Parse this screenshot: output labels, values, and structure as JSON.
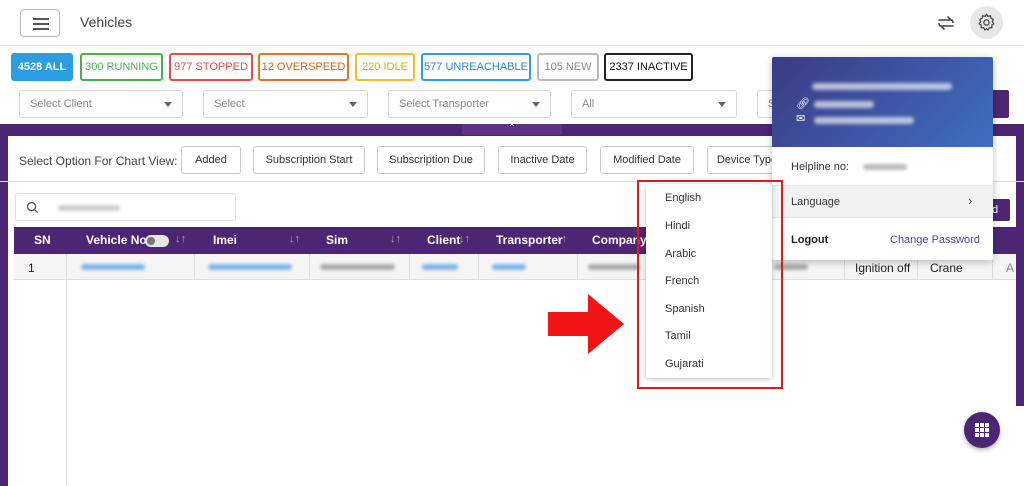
{
  "header": {
    "title": "Vehicles"
  },
  "status_chips": [
    {
      "label": "4528 ALL"
    },
    {
      "label": "300 RUNNING"
    },
    {
      "label": "977 STOPPED"
    },
    {
      "label": "12 OVERSPEED"
    },
    {
      "label": "220 IDLE"
    },
    {
      "label": "577 UNREACHABLE"
    },
    {
      "label": "105 NEW"
    },
    {
      "label": "2337 INACTIVE"
    }
  ],
  "filters": {
    "client_placeholder": "Select Client",
    "select_placeholder": "Select",
    "transporter_placeholder": "Select Transporter",
    "all_value": "All",
    "partial_label": "S"
  },
  "chart_view": {
    "label": "Select Option For Chart View:",
    "options": [
      "Added",
      "Subscription Start",
      "Subscription Due",
      "Inactive Date",
      "Modified Date",
      "Device Type"
    ]
  },
  "table": {
    "columns": [
      "SN",
      "Vehicle No.",
      "Imei",
      "Sim",
      "Client",
      "Transporter",
      "Company"
    ],
    "row": {
      "sn": "1",
      "ignition": "Ignition off",
      "type": "Crane",
      "edge": "A"
    }
  },
  "add_button_edge": "d",
  "profile_menu": {
    "helpline_label": "Helpline no:",
    "language_label": "Language",
    "logout_label": "Logout",
    "change_password_label": "Change Password"
  },
  "languages": [
    "English",
    "Hindi",
    "Arabic",
    "French",
    "Spanish",
    "Tamil",
    "Gujarati"
  ],
  "colors": {
    "primary": "#4d2673",
    "running": "#4cb050",
    "stopped": "#e74c4c",
    "overspeed": "#e0752a",
    "idle": "#f0bd2c",
    "unreachable": "#2a9ee0",
    "highlight": "#e01b1b"
  },
  "icons": [
    "hamburger-menu-icon",
    "refresh-icon",
    "gear-icon",
    "search-icon",
    "chevron-right-icon",
    "link-icon",
    "mail-icon",
    "arrow-right-icon",
    "grid-apps-icon"
  ]
}
